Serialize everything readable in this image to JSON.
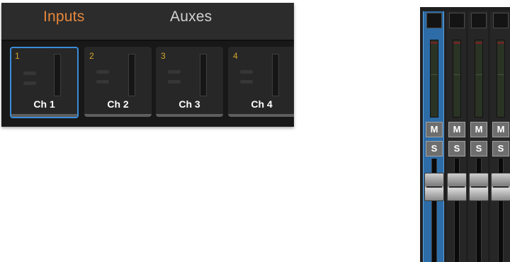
{
  "tabs": {
    "inputs": "Inputs",
    "auxes": "Auxes",
    "active": "inputs",
    "active_color": "#e6873a"
  },
  "channels": [
    {
      "number": "1",
      "label": "Ch 1",
      "selected": true
    },
    {
      "number": "2",
      "label": "Ch 2",
      "selected": false
    },
    {
      "number": "3",
      "label": "Ch 3",
      "selected": false
    },
    {
      "number": "4",
      "label": "Ch 4",
      "selected": false
    }
  ],
  "mixer": {
    "mute_label": "M",
    "solo_label": "S",
    "selected_color": "#2d6ca7"
  }
}
